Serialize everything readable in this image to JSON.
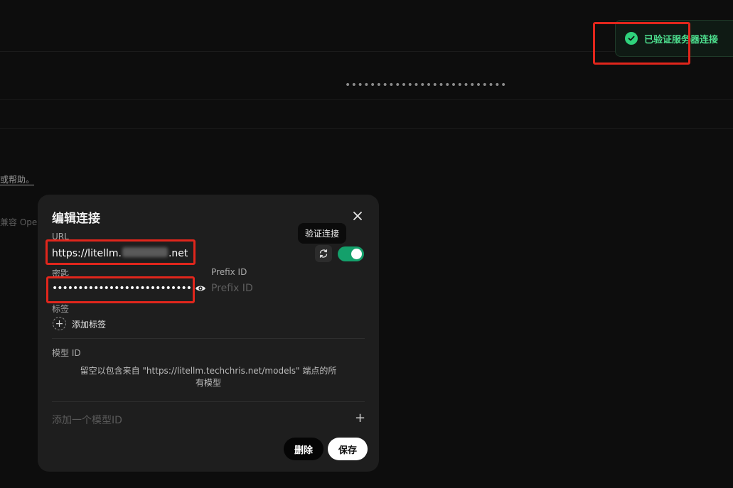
{
  "background": {
    "masked_value": "••••••••••••••••••••••••••",
    "help_link": "或帮助。",
    "compat_text": "兼容 Ope"
  },
  "toast": {
    "message": "已验证服务器连接",
    "icon": "check-circle-icon",
    "color": "#4ee08f"
  },
  "modal": {
    "title": "编辑连接",
    "close_icon": "close-icon",
    "url": {
      "label": "URL",
      "value_prefix": "https://litellm.",
      "value_suffix": ".net"
    },
    "verify_tooltip": "验证连接",
    "refresh_icon": "refresh-icon",
    "toggle_enabled": true,
    "key": {
      "label": "密匙",
      "value": "••••••••••••••••••••••••••••"
    },
    "prefix_id": {
      "label": "Prefix ID",
      "placeholder": "Prefix ID"
    },
    "tags": {
      "label": "标签",
      "add_label": "添加标签"
    },
    "model_id": {
      "label": "模型 ID",
      "hint": "留空以包含来自 \"https://litellm.techchris.net/models\" 端点的所有模型",
      "add_placeholder": "添加一个模型ID",
      "add_icon": "plus-icon"
    },
    "buttons": {
      "delete": "删除",
      "save": "保存"
    }
  },
  "colors": {
    "accent_green": "#14a06b",
    "highlight_red": "#e1261c"
  }
}
